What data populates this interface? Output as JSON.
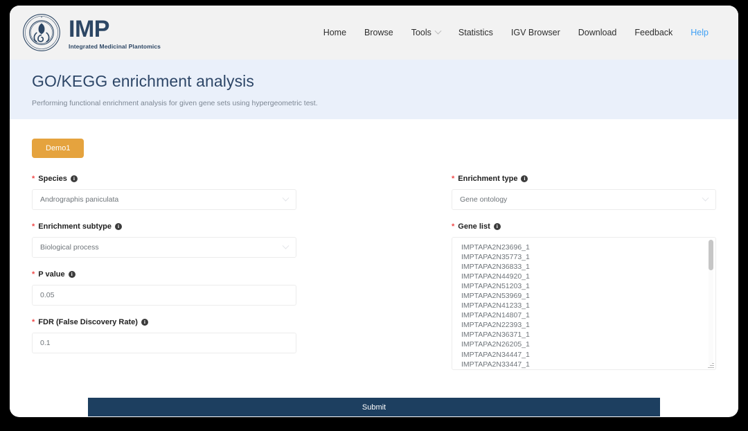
{
  "header": {
    "logo_title": "IMP",
    "logo_subtitle": "Integrated Medicinal Plantomics",
    "seal_icon": "institution-seal-icon",
    "nav": [
      {
        "label": "Home",
        "has_caret": false
      },
      {
        "label": "Browse",
        "has_caret": false
      },
      {
        "label": "Tools",
        "has_caret": true
      },
      {
        "label": "Statistics",
        "has_caret": false
      },
      {
        "label": "IGV Browser",
        "has_caret": false
      },
      {
        "label": "Download",
        "has_caret": false
      },
      {
        "label": "Feedback",
        "has_caret": false
      },
      {
        "label": "Help",
        "has_caret": false
      }
    ]
  },
  "hero": {
    "title": "GO/KEGG enrichment analysis",
    "subtitle": "Performing functional enrichment analysis for given gene sets using hypergeometric test.",
    "background": "#eaf0fa",
    "title_color": "#2d4667"
  },
  "form": {
    "demo_button": "Demo1",
    "demo_button_color": "#e5a33e",
    "required_marker": "*",
    "info_glyph": "i",
    "species": {
      "label": "Species",
      "value": "Andrographis paniculata",
      "icon": "info-icon"
    },
    "enrichment_type": {
      "label": "Enrichment type",
      "value": "Gene ontology",
      "icon": "info-icon"
    },
    "enrichment_subtype": {
      "label": "Enrichment subtype",
      "value": "Biological process",
      "icon": "info-icon"
    },
    "p_value": {
      "label": "P value",
      "value": "0.05",
      "icon": "info-icon"
    },
    "fdr": {
      "label": "FDR (False Discovery Rate)",
      "value": "0.1",
      "icon": "info-icon"
    },
    "gene_list": {
      "label": "Gene list",
      "icon": "info-icon",
      "values": [
        "IMPTAPA2N23696_1",
        "IMPTAPA2N35773_1",
        "IMPTAPA2N36833_1",
        "IMPTAPA2N44920_1",
        "IMPTAPA2N51203_1",
        "IMPTAPA2N53969_1",
        "IMPTAPA2N41233_1",
        "IMPTAPA2N14807_1",
        "IMPTAPA2N22393_1",
        "IMPTAPA2N36371_1",
        "IMPTAPA2N26205_1",
        "IMPTAPA2N34447_1",
        "IMPTAPA2N33447_1"
      ]
    },
    "submit_button": "Submit",
    "submit_button_color": "#1d3f60"
  }
}
